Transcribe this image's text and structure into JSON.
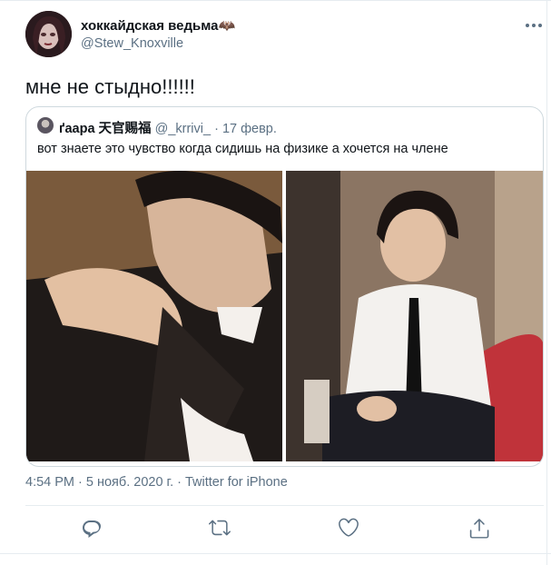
{
  "author": {
    "name": "хоккайдская ведьма🦇",
    "handle": "@Stew_Knoxville"
  },
  "tweet": {
    "text": "мне не стыдно!!!!!!"
  },
  "quoted_tweet": {
    "name": "ґаара 天官赐福",
    "handle": "@_krrivi_",
    "separator": "·",
    "date": "17 февр.",
    "text": "вот знаете это чувство когда сидишь на физике а хочется на члене"
  },
  "meta": {
    "text": "4:54 PM · 5 нояб. 2020 г. · Twitter for iPhone"
  },
  "actions": {
    "icons": [
      "reply-icon",
      "retweet-icon",
      "like-icon",
      "share-icon"
    ]
  },
  "colors": {
    "text": "#0f1419",
    "secondary": "#5b7083",
    "border": "#cfd9de",
    "accent": "#1da1f2"
  }
}
